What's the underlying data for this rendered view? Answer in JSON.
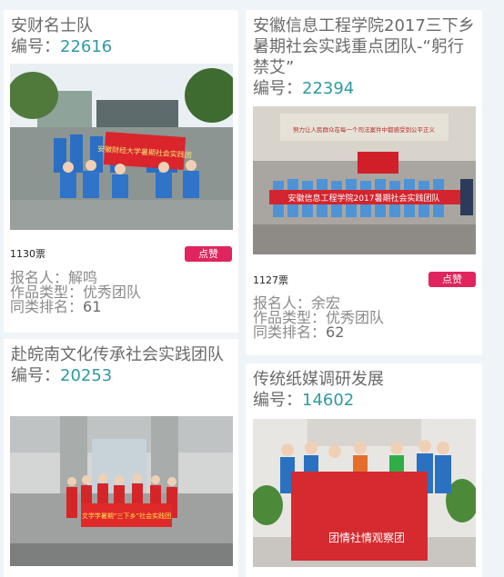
{
  "cards": [
    {
      "title": "安财名士队",
      "number_label": "编号：",
      "number": "22616",
      "votes": "1130票",
      "like_label": "点赞",
      "applicant_label": "报名人：",
      "applicant": "解鸣",
      "category_label": "作品类型：",
      "category": "优秀团队",
      "rank_label": "同类排名：",
      "rank": "61",
      "photo": {
        "banner_text": "安徽财经大学暑期社会实践团"
      }
    },
    {
      "title": "安徽信息工程学院2017三下乡暑期社会实践重点团队-“躬行禁艾”",
      "number_label": "编号：",
      "number": "22394",
      "votes": "1127票",
      "like_label": "点赞",
      "applicant_label": "报名人：",
      "applicant": "余宏",
      "category_label": "作品类型：",
      "category": "优秀团队",
      "rank_label": "同类排名：",
      "rank": "62",
      "photo": {
        "banner_text": "安徽信息工程学院2017暑期社会实践团队",
        "wall_text": "努力让人民群众在每一个司法案件中都感受到公平正义"
      }
    },
    {
      "title": "赴皖南文化传承社会实践团队",
      "number_label": "编号：",
      "number": "20253",
      "photo": {
        "banner_text": "文学学暑期“三下乡”社会实践团"
      }
    },
    {
      "title": "传统纸媒调研发展",
      "number_label": "编号：",
      "number": "14602",
      "photo": {
        "banner_text": "团情社情观察团"
      }
    }
  ]
}
